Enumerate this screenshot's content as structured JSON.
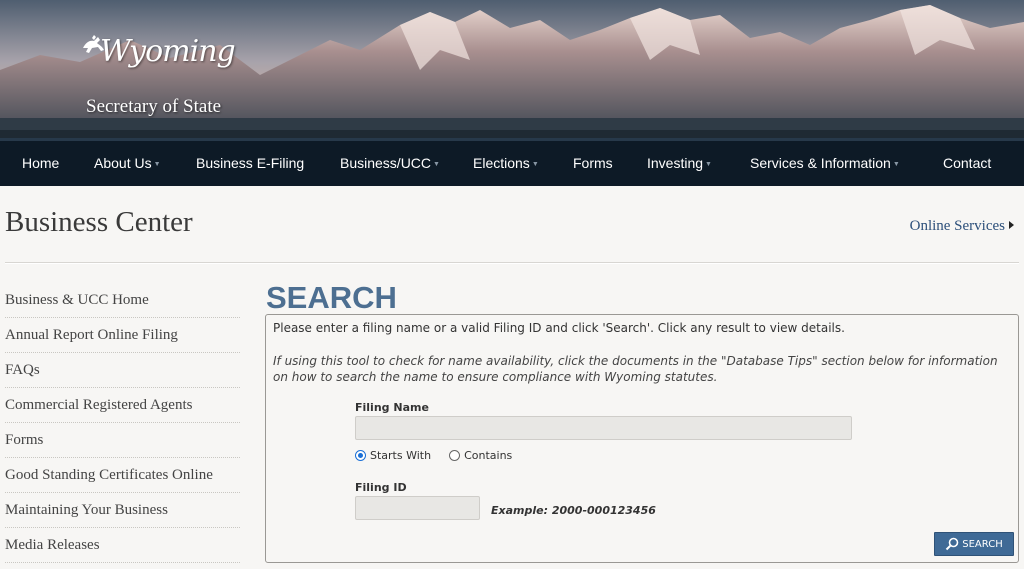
{
  "banner": {
    "logo_script": "Wyoming",
    "logo_subtitle": "Secretary of State"
  },
  "nav": {
    "items": [
      {
        "label": "Home",
        "has_dropdown": false
      },
      {
        "label": "About Us",
        "has_dropdown": true
      },
      {
        "label": "Business E-Filing",
        "has_dropdown": false
      },
      {
        "label": "Business/UCC",
        "has_dropdown": true
      },
      {
        "label": "Elections",
        "has_dropdown": true
      },
      {
        "label": "Forms",
        "has_dropdown": false
      },
      {
        "label": "Investing",
        "has_dropdown": true
      },
      {
        "label": "Services & Information",
        "has_dropdown": true
      },
      {
        "label": "Contact",
        "has_dropdown": false
      }
    ]
  },
  "header": {
    "title": "Business Center",
    "online_services": "Online Services"
  },
  "sidebar": {
    "items": [
      {
        "label": "Business & UCC Home"
      },
      {
        "label": "Annual Report Online Filing"
      },
      {
        "label": "FAQs"
      },
      {
        "label": "Commercial Registered Agents"
      },
      {
        "label": "Forms"
      },
      {
        "label": "Good Standing Certificates Online"
      },
      {
        "label": "Maintaining Your Business"
      },
      {
        "label": "Media Releases"
      }
    ]
  },
  "search": {
    "heading": "SEARCH",
    "intro": "Please enter a filing name or a valid Filing ID and click 'Search'. Click any result to view details.",
    "tips": "If using this tool to check for name availability, click the documents in the \"Database Tips\" section below for information on how to search the name to ensure compliance with Wyoming statutes.",
    "filing_name_label": "Filing Name",
    "filing_name_value": "",
    "match_options": [
      {
        "label": "Starts With",
        "selected": true
      },
      {
        "label": "Contains",
        "selected": false
      }
    ],
    "filing_id_label": "Filing ID",
    "filing_id_value": "",
    "example": "Example: 2000-000123456",
    "button_label": "SEARCH"
  },
  "colors": {
    "nav_bg": "#0d1a26",
    "heading_blue": "#4d6f91",
    "button_blue": "#3f6a96",
    "link_blue": "#2c4f7a",
    "page_bg": "#f7f6f4"
  }
}
